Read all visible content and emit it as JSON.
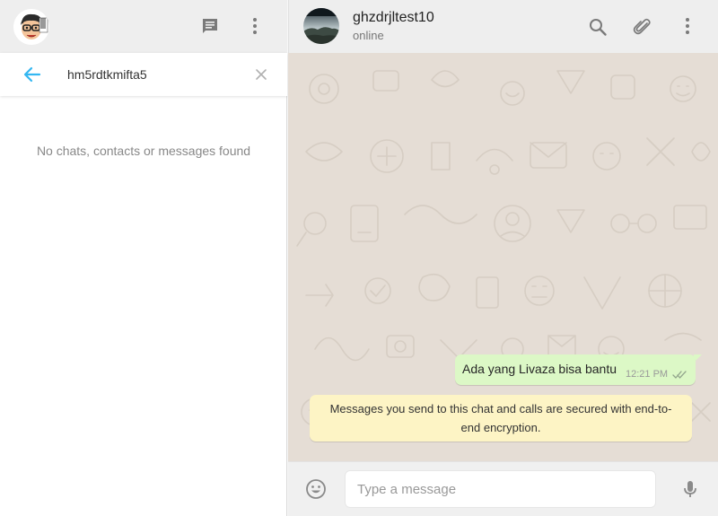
{
  "sidebar": {
    "avatar_icon": "cartoon-avatar-icon",
    "new_chat_icon": "message-icon",
    "menu_icon": "more-vertical-icon",
    "search": {
      "back_icon": "arrow-left-icon",
      "value": "hm5rdtkmifta5",
      "clear_icon": "close-icon"
    },
    "empty_message": "No chats, contacts or messages found"
  },
  "chat": {
    "contact_name": "ghzdrjltest10",
    "contact_status": "online",
    "header_icons": [
      "search-icon",
      "paperclip-icon",
      "more-vertical-icon"
    ],
    "messages": [
      {
        "direction": "outgoing",
        "text": "Ada yang Livaza bisa bantu",
        "time": "12:21 PM",
        "status": "delivered-double-check"
      }
    ],
    "encryption_notice": "Messages you send to this chat and calls are secured with end-to-end encryption.",
    "compose": {
      "placeholder": "Type a message",
      "emoji_icon": "smiley-icon",
      "mic_icon": "microphone-icon"
    }
  },
  "colors": {
    "header_bg": "#eeeeee",
    "chat_bg": "#e5ddd5",
    "outgoing_bubble": "#dcf8c6",
    "notice_bubble": "#fdf4c5",
    "accent": "#34b7f1"
  }
}
